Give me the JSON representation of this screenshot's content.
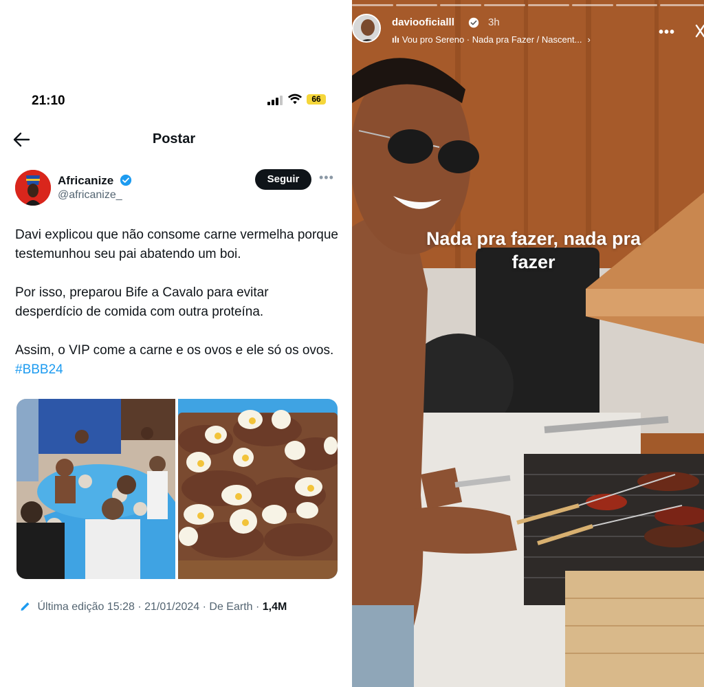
{
  "tweet": {
    "status_bar": {
      "time": "21:10",
      "battery": "66"
    },
    "header": {
      "title": "Postar"
    },
    "author": {
      "name": "Africanize",
      "handle": "@africanize_"
    },
    "follow_label": "Seguir",
    "paragraphs": [
      "Davi explicou que não consome carne vermelha porque testemunhou seu pai abatendo um boi.",
      "Por isso, preparou Bife a Cavalo para evitar desperdício de comida com outra proteína.",
      "Assim, o VIP come a carne e os ovos e ele só os ovos."
    ],
    "hashtag": "#BBB24",
    "meta": {
      "edited": "Última edição 15:28 · 21/01/2024",
      "source": "De Earth",
      "views": "1,4M"
    }
  },
  "story": {
    "username": "daviooficialll",
    "time": "3h",
    "music": "Vou pro Sereno · Nada pra Fazer / Nascent...",
    "caption": "Nada pra fazer, nada pra fazer"
  },
  "colors": {
    "accent": "#1d9bf0",
    "text": "#0f1419",
    "muted": "#536471",
    "battery": "#f5d63a",
    "avatar_red": "#d9261c"
  }
}
